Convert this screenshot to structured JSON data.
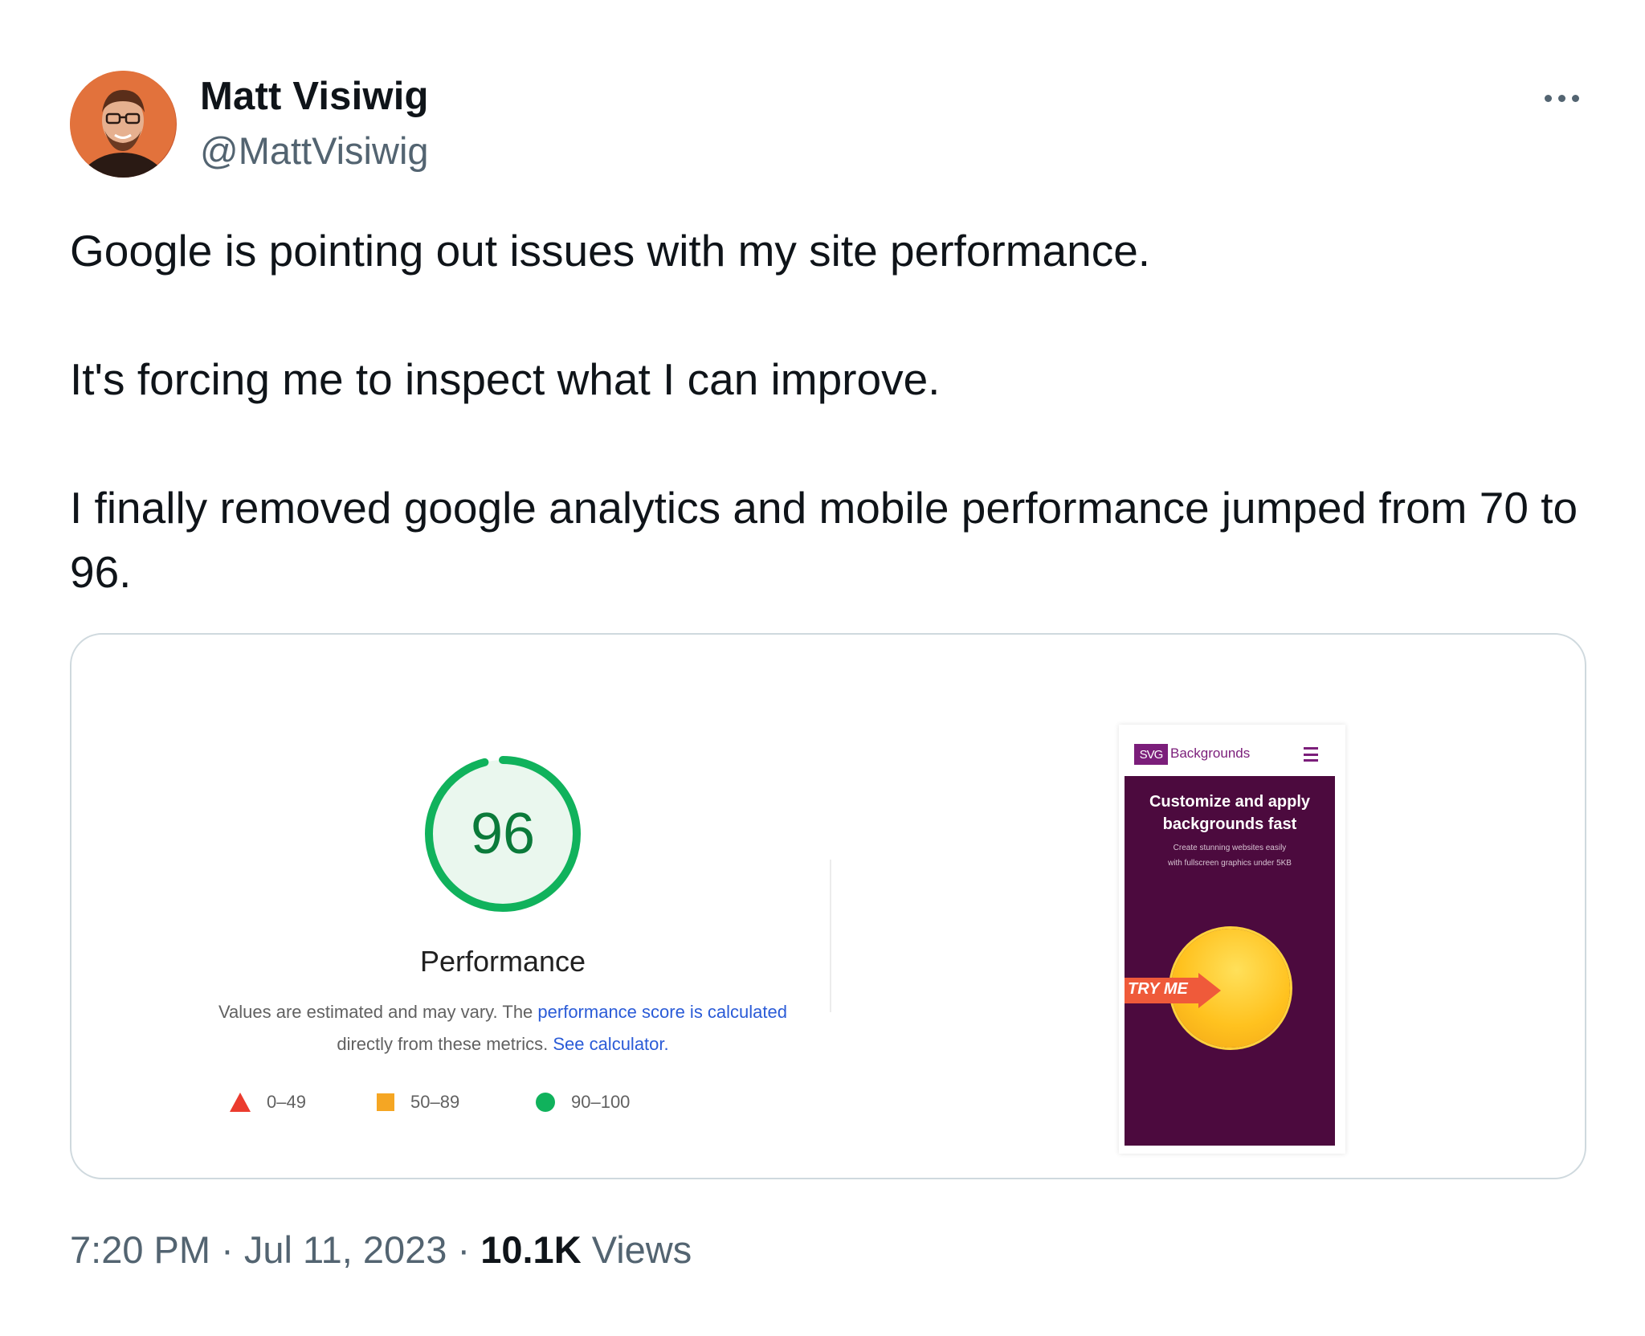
{
  "author": {
    "display_name": "Matt Visiwig",
    "handle": "@MattVisiwig"
  },
  "tweet": {
    "paragraphs": [
      "Google is pointing out issues with my site performance.",
      "It's forcing me to inspect what I can improve.",
      "I finally removed google analytics and mobile performance jumped from 70 to 96."
    ]
  },
  "media": {
    "score": {
      "value": 96,
      "fraction": 0.96
    },
    "title": "Performance",
    "description": {
      "prefix": "Values are estimated and may vary. The ",
      "link1": "performance score is calculated",
      "middle": " directly from these metrics. ",
      "link2": "See calculator."
    },
    "legend": [
      {
        "label": "0–49",
        "shape": "triangle",
        "color": "#eb3b2e"
      },
      {
        "label": "50–89",
        "shape": "square",
        "color": "#f5a623"
      },
      {
        "label": "90–100",
        "shape": "circle",
        "color": "#10b25c"
      }
    ],
    "phone": {
      "logo_box": "SVG",
      "logo_text": "Backgrounds",
      "hero_title_line1": "Customize and apply",
      "hero_title_line2": "backgrounds fast",
      "hero_sub_line1": "Create stunning websites easily",
      "hero_sub_line2": "with fullscreen graphics under 5KB",
      "cta": "TRY ME"
    }
  },
  "footer": {
    "time": "7:20 PM",
    "separator": " · ",
    "date": "Jul 11, 2023",
    "views_count": "10.1K",
    "views_label": "Views"
  },
  "icons": {
    "more": "more-horizontal-icon",
    "menu": "hamburger-menu-icon"
  },
  "colors": {
    "text": "#0f1419",
    "secondary": "#536471",
    "border": "#cfd9de",
    "gauge_green": "#10b25c",
    "brand_purple": "#7b1e7a"
  }
}
